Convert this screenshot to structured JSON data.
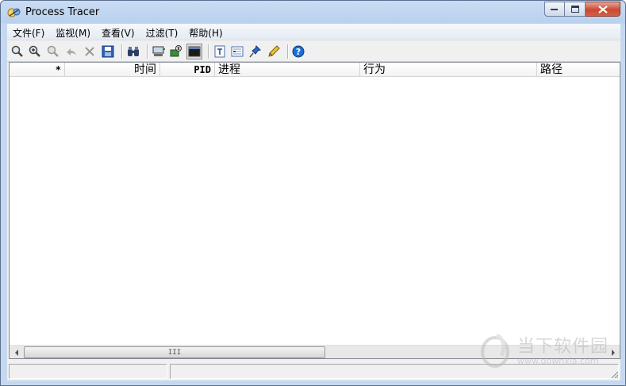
{
  "window": {
    "title": "Process Tracer"
  },
  "menu": [
    {
      "label": "文件(F)"
    },
    {
      "label": "监视(M)"
    },
    {
      "label": "查看(V)"
    },
    {
      "label": "过滤(T)"
    },
    {
      "label": "帮助(H)"
    }
  ],
  "toolbar": {
    "icons": [
      "magnifier-icon",
      "zoom-in-icon",
      "zoom-disabled-icon",
      "undo-disabled-icon",
      "delete-disabled-icon",
      "save-icon",
      "find-binoculars-icon",
      "network-monitor-icon",
      "process-tree-icon",
      "console-window-icon",
      "text-document-icon",
      "properties-list-icon",
      "pin-icon",
      "highlight-pen-icon",
      "help-icon"
    ]
  },
  "list": {
    "columns": [
      {
        "label": "*"
      },
      {
        "label": "时间"
      },
      {
        "label": "PID"
      },
      {
        "label": "进程"
      },
      {
        "label": "行为"
      },
      {
        "label": "路径"
      }
    ],
    "rows": []
  },
  "scrollbar": {
    "grip": "III"
  },
  "status": {
    "panel1": "",
    "panel2": ""
  },
  "watermark": {
    "brand": "当下软件园",
    "url": "www.downxia.com"
  },
  "colors": {
    "title_gradient_top": "#c9dcf2",
    "close_button": "#c8492f",
    "help_icon": "#1a6fd1"
  }
}
